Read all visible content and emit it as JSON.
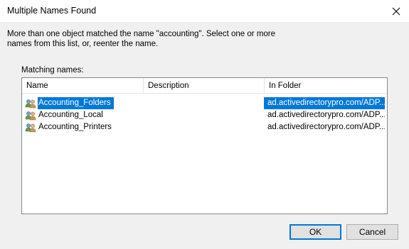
{
  "window": {
    "title": "Multiple Names Found"
  },
  "message": "More than one object matched the name \"accounting\". Select one or more names from this list, or, reenter the name.",
  "list": {
    "label": "Matching names:",
    "columns": [
      "Name",
      "Description",
      "In Folder"
    ],
    "rows": [
      {
        "name": "Accounting_Folders",
        "description": "",
        "folder": "ad.activedirectorypro.com/ADP...",
        "selected": true
      },
      {
        "name": "Accounting_Local",
        "description": "",
        "folder": "ad.activedirectorypro.com/ADP...",
        "selected": false
      },
      {
        "name": "Accounting_Printers",
        "description": "",
        "folder": "ad.activedirectorypro.com/ADP...",
        "selected": false
      }
    ]
  },
  "buttons": {
    "ok": "OK",
    "cancel": "Cancel"
  },
  "icons": {
    "close": "close-icon",
    "group": "group-icon"
  },
  "colors": {
    "selection": "#0078d7",
    "dialog_bg": "#f0f0f0"
  }
}
